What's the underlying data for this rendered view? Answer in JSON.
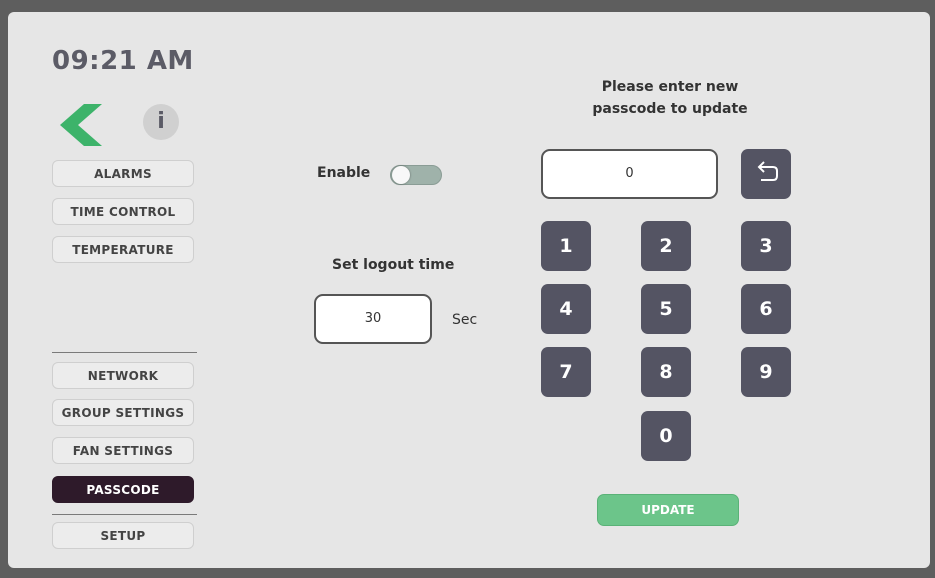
{
  "clock": {
    "time": "09:21 AM"
  },
  "icons": {
    "back": "chevron-left-icon",
    "info": "info-icon",
    "backspace": "undo-icon"
  },
  "info_glyph": "i",
  "nav_top": [
    {
      "label": "ALARMS"
    },
    {
      "label": "TIME CONTROL"
    },
    {
      "label": "TEMPERATURE"
    }
  ],
  "nav_bottom": [
    {
      "label": "NETWORK"
    },
    {
      "label": "GROUP SETTINGS"
    },
    {
      "label": "FAN SETTINGS"
    },
    {
      "label": "PASSCODE",
      "active": true
    },
    {
      "label": "SETUP"
    }
  ],
  "enable": {
    "label": "Enable",
    "on": false
  },
  "logout": {
    "label": "Set logout time",
    "value": "30",
    "unit": "Sec"
  },
  "passcode": {
    "prompt_line1": "Please enter new",
    "prompt_line2": "passcode to update",
    "value": "0"
  },
  "keypad": [
    "1",
    "2",
    "3",
    "4",
    "5",
    "6",
    "7",
    "8",
    "9",
    "0"
  ],
  "update_label": "UPDATE",
  "colors": {
    "active_nav": "#2e1a2a",
    "key": "#545463",
    "update": "#6cc58a",
    "back_arrow": "#3db36a"
  }
}
